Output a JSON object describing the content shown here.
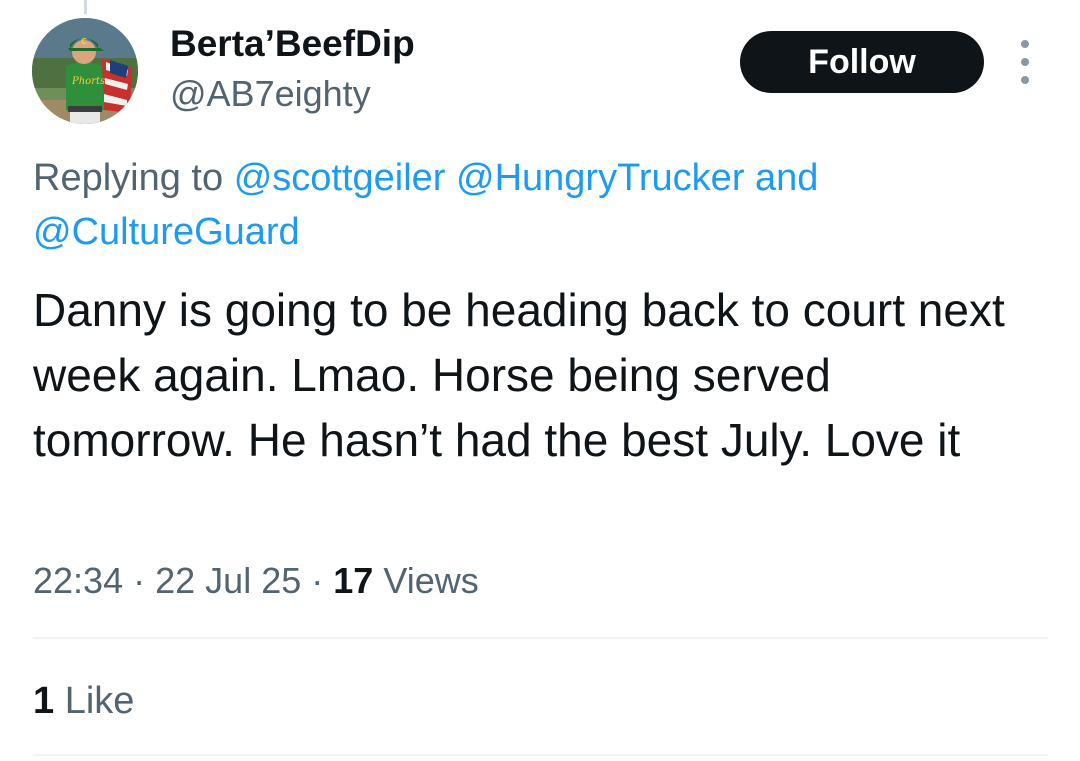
{
  "author": {
    "display_name": "Berta’BeefDip",
    "handle": "@AB7eighty",
    "avatar_icon": "profile-photo-baseball-player"
  },
  "follow_label": "Follow",
  "more_icon": "more-options-vertical-icon",
  "reply_context": {
    "prefix": "Replying to",
    "mentions": [
      "@scottgeiler",
      "@HungryTrucker",
      "@CultureGuard"
    ],
    "conjunction": "and"
  },
  "tweet": {
    "text": "Danny is going to be heading back to court next week again. Lmao. Horse being served tomorrow. He hasn’t had the best July. Love it",
    "time": "22:34",
    "date": "22 Jul 25",
    "separator": "·",
    "views_count": "17",
    "views_label": "Views"
  },
  "engagement": {
    "likes_count": "1",
    "likes_label": "Like"
  },
  "colors": {
    "text": "#0f1419",
    "secondary": "#536471",
    "link": "#1d9bf0",
    "divider": "#eff3f4",
    "button_bg": "#0f1419"
  }
}
